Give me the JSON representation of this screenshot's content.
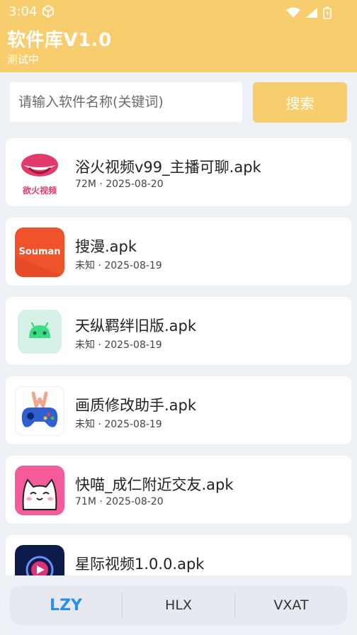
{
  "status_bar": {
    "time": "3:04"
  },
  "header": {
    "title": "软件库V1.0",
    "subtitle": "测试中"
  },
  "search": {
    "placeholder": "请输入软件名称(关键词)",
    "button_label": "搜索"
  },
  "apps": [
    {
      "name": "浴火视频v99_主播可聊.apk",
      "meta": "72M · 2025-08-20",
      "icon": "lips-icon",
      "icon_text": "欲火视频"
    },
    {
      "name": "搜漫.apk",
      "meta": "未知 · 2025-08-19",
      "icon": "souman-icon",
      "icon_text": "Souman"
    },
    {
      "name": "天纵羁绊旧版.apk",
      "meta": "未知 · 2025-08-19",
      "icon": "android-icon"
    },
    {
      "name": "画质修改助手.apk",
      "meta": "未知 · 2025-08-19",
      "icon": "gamepad-icon"
    },
    {
      "name": "快喵_成仁附近交友.apk",
      "meta": "71M · 2025-08-20",
      "icon": "cat-icon"
    },
    {
      "name": "星际视频1.0.0.apk",
      "meta": "",
      "icon": "play-icon"
    }
  ],
  "tabs": [
    {
      "label": "LZY",
      "active": true
    },
    {
      "label": "HLX",
      "active": false
    },
    {
      "label": "VXAT",
      "active": false
    }
  ],
  "colors": {
    "header": "#f8cd6d",
    "active_tab": "#2a8fe6",
    "background": "#eef1f5"
  }
}
